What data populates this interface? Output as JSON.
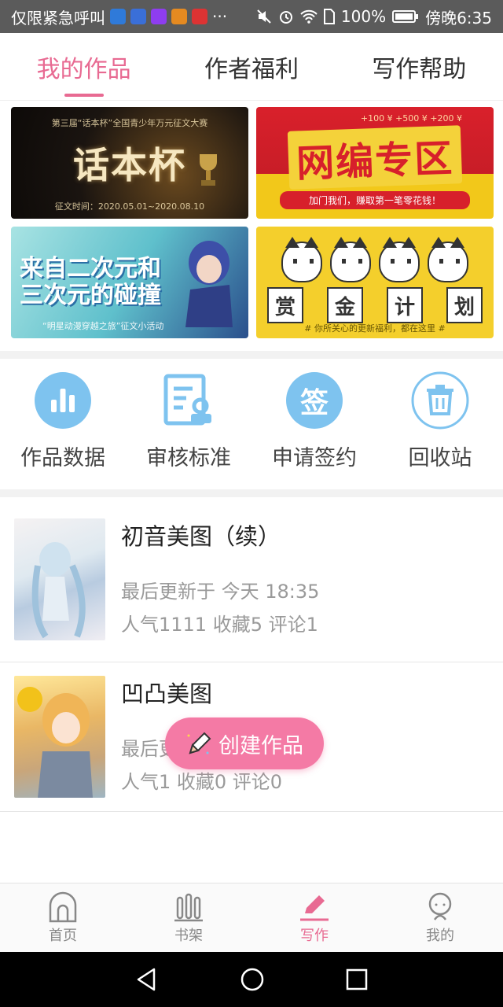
{
  "status_bar": {
    "carrier": "仅限紧急呼叫",
    "more": "···",
    "battery": "100%",
    "time": "傍晚6:35"
  },
  "tabs": [
    {
      "label": "我的作品",
      "active": true
    },
    {
      "label": "作者福利",
      "active": false
    },
    {
      "label": "写作帮助",
      "active": false
    }
  ],
  "banners": {
    "b1": {
      "top": "第三届“话本杯”全国青少年万元征文大赛",
      "title": "话本杯",
      "foot": "征文时间：2020.05.01~2020.08.10"
    },
    "b2": {
      "top": "+100 ¥ +500 ¥ +200 ¥",
      "title": "网编专区",
      "tag": "加门我们，赚取第一笔零花钱！"
    },
    "b3": {
      "title": "来自二次元和三次元的碰撞",
      "foot": "“明星动漫穿越之旅”征文小活动"
    },
    "b4": {
      "chars": [
        "赏",
        "金",
        "计",
        "划"
      ],
      "foot": "# 你所关心的更新福利，都在这里 #"
    }
  },
  "entries": [
    {
      "label": "作品数据",
      "icon": "bar-chart-icon"
    },
    {
      "label": "审核标准",
      "icon": "document-check-icon"
    },
    {
      "label": "申请签约",
      "icon": "sign-icon",
      "icon_text": "签"
    },
    {
      "label": "回收站",
      "icon": "trash-icon"
    }
  ],
  "works": [
    {
      "title": "初音美图（续）",
      "updated": "最后更新于 今天 18:35",
      "stats": "人气1111  收藏5  评论1"
    },
    {
      "title": "凹凸美图",
      "updated": "最后更新于 今天 18:33",
      "stats": "人气1  收藏0  评论0"
    }
  ],
  "fab": {
    "label": "创建作品"
  },
  "bottom_nav": [
    {
      "label": "首页",
      "active": false
    },
    {
      "label": "书架",
      "active": false
    },
    {
      "label": "写作",
      "active": true
    },
    {
      "label": "我的",
      "active": false
    }
  ],
  "colors": {
    "accent": "#e86a92",
    "fab": "#f47aa5",
    "icon_blue": "#7ec3ef"
  }
}
